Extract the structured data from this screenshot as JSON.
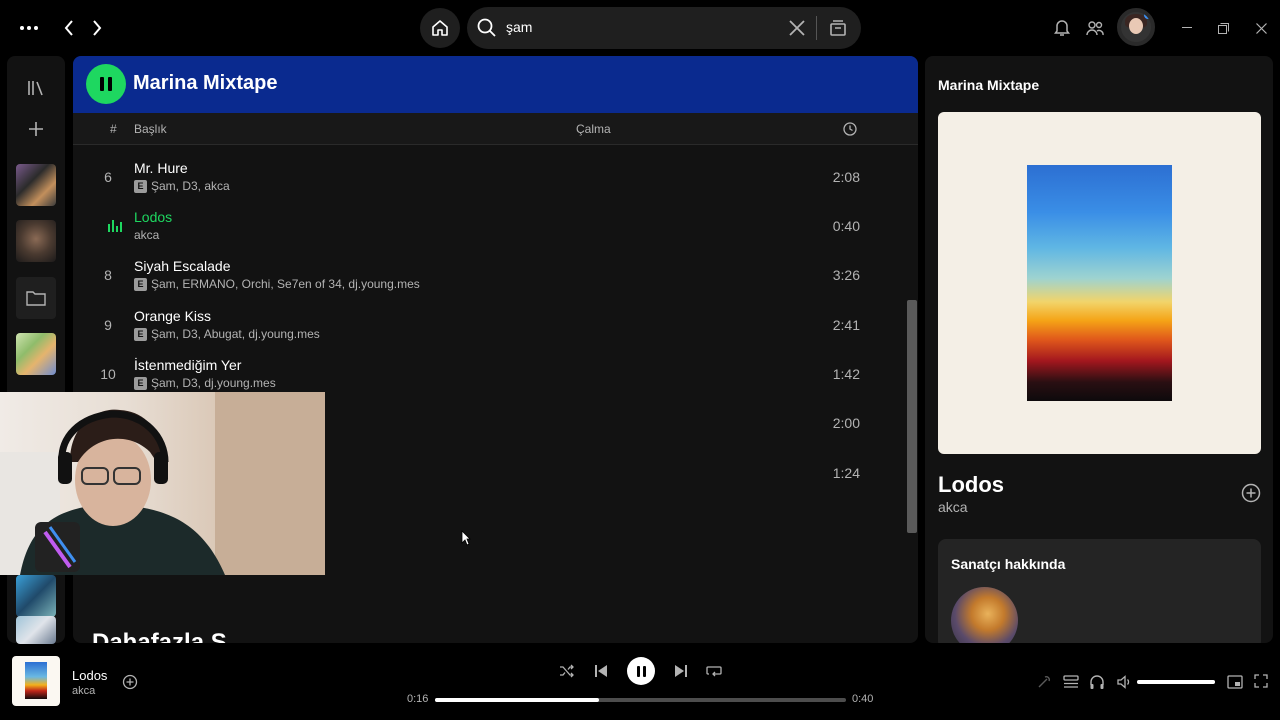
{
  "search": {
    "value": "şam"
  },
  "main": {
    "title": "Marina Mixtape",
    "columns": {
      "number": "#",
      "title": "Başlık",
      "plays": "Çalma"
    },
    "tracks": [
      {
        "num": "6",
        "title": "Mr. Hure",
        "artists": "Şam, D3, akca",
        "explicit": true,
        "duration": "2:08",
        "playing": false
      },
      {
        "num": "",
        "title": "Lodos",
        "artists": "akca",
        "explicit": false,
        "duration": "0:40",
        "playing": true
      },
      {
        "num": "8",
        "title": "Siyah Escalade",
        "artists": "Şam, ERMANO, Orchi, Se7en of 34, dj.young.mes",
        "explicit": true,
        "duration": "3:26",
        "playing": false
      },
      {
        "num": "9",
        "title": "Orange Kiss",
        "artists": "Şam, D3, Abugat, dj.young.mes",
        "explicit": true,
        "duration": "2:41",
        "playing": false
      },
      {
        "num": "10",
        "title": "İstenmediğim Yer",
        "artists": "Şam, D3, dj.young.mes",
        "explicit": true,
        "duration": "1:42",
        "playing": false
      },
      {
        "num": "",
        "title": "",
        "artists": "",
        "explicit": false,
        "duration": "2:00",
        "playing": false
      },
      {
        "num": "",
        "title": "",
        "artists": "",
        "explicit": false,
        "duration": "1:24",
        "playing": false
      }
    ],
    "explicit_badge": "E",
    "next_section_peek": "Dahafazla S"
  },
  "right_panel": {
    "playlist_title": "Marina Mixtape",
    "song_title": "Lodos",
    "artist": "akca",
    "about_title": "Sanatçı hakkında"
  },
  "now_playing": {
    "title": "Lodos",
    "artist": "akca",
    "elapsed": "0:16",
    "total": "0:40",
    "progress": 0.4,
    "volume": 1.0
  },
  "colors": {
    "accent": "#1ed760",
    "header": "#0a2a8f"
  }
}
